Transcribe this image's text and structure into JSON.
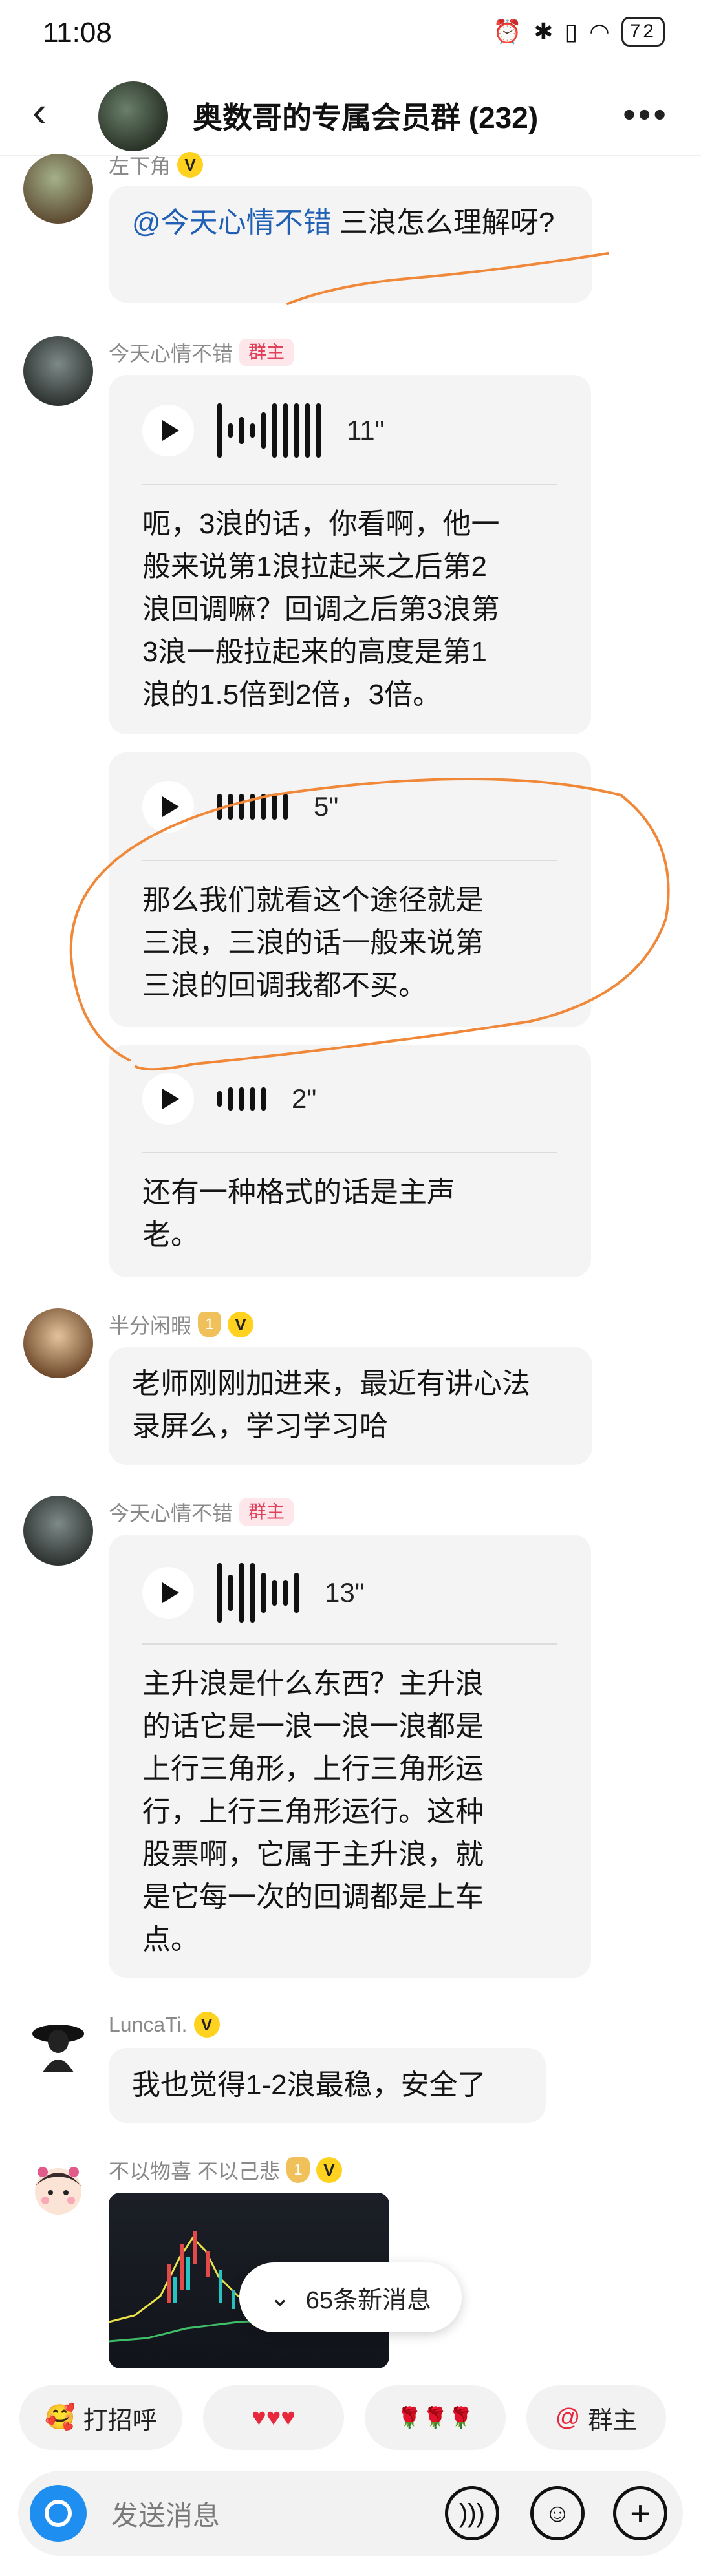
{
  "status_bar": {
    "time": "11:08",
    "battery": "72"
  },
  "header": {
    "title": "奥数哥的专属会员群 (232)"
  },
  "messages": [
    {
      "sender": "左下角",
      "text": "三浪怎么理解呀?",
      "mention": "@今天心情不错 ",
      "text_line2": "呀?"
    },
    {
      "sender": "今天心情不错",
      "role": "群主",
      "voices": [
        {
          "duration": "11\"",
          "transcript": [
            "呃，3浪的话，你看啊，他一",
            "般来说第1浪拉起来之后第2",
            "浪回调嘛？回调之后第3浪第",
            "3浪一般拉起来的高度是第1",
            "浪的1.5倍到2倍，3倍。"
          ]
        },
        {
          "duration": "5\"",
          "transcript": [
            "那么我们就看这个途径就是",
            "三浪，三浪的话一般来说第",
            "三浪的回调我都不买。"
          ]
        },
        {
          "duration": "2\"",
          "transcript": [
            "还有一种格式的话是主声",
            "老。"
          ]
        }
      ]
    },
    {
      "sender": "半分闲暇",
      "lines": [
        "老师刚刚加进来，最近有讲心法",
        "录屏么，学习学习哈"
      ]
    },
    {
      "sender": "今天心情不错",
      "role": "群主",
      "voice": {
        "duration": "13\"",
        "transcript": [
          "主升浪是什么东西？主升浪",
          "的话它是一浪一浪一浪都是",
          "上行三角形，上行三角形运",
          "行，上行三角形运行。这种",
          "股票啊，它属于主升浪，就",
          "是它每一次的回调都是上车",
          "点。"
        ]
      }
    },
    {
      "sender": "LuncaTi.",
      "text": "我也觉得1-2浪最稳，安全了"
    },
    {
      "sender": "不以物喜 不以己悲"
    }
  ],
  "new_messages": "65条新消息",
  "quick_chips": [
    {
      "emoji": "🥰",
      "label": "打招呼"
    },
    {
      "emoji": "♥♥♥",
      "label": ""
    },
    {
      "emoji": "🌹🌹🌹",
      "label": ""
    },
    {
      "emoji": "@",
      "label": "群主"
    }
  ],
  "input": {
    "placeholder": "发送消息"
  },
  "colors": {
    "accent_blue": "#1e8ef0",
    "annotation_orange": "#f0883a",
    "owner_badge": "#e0415b"
  },
  "icons": [
    "back-icon",
    "more-icon",
    "play-icon",
    "chevron-down-icon",
    "camera-icon",
    "voice-input-icon",
    "emoji-icon",
    "plus-icon"
  ]
}
